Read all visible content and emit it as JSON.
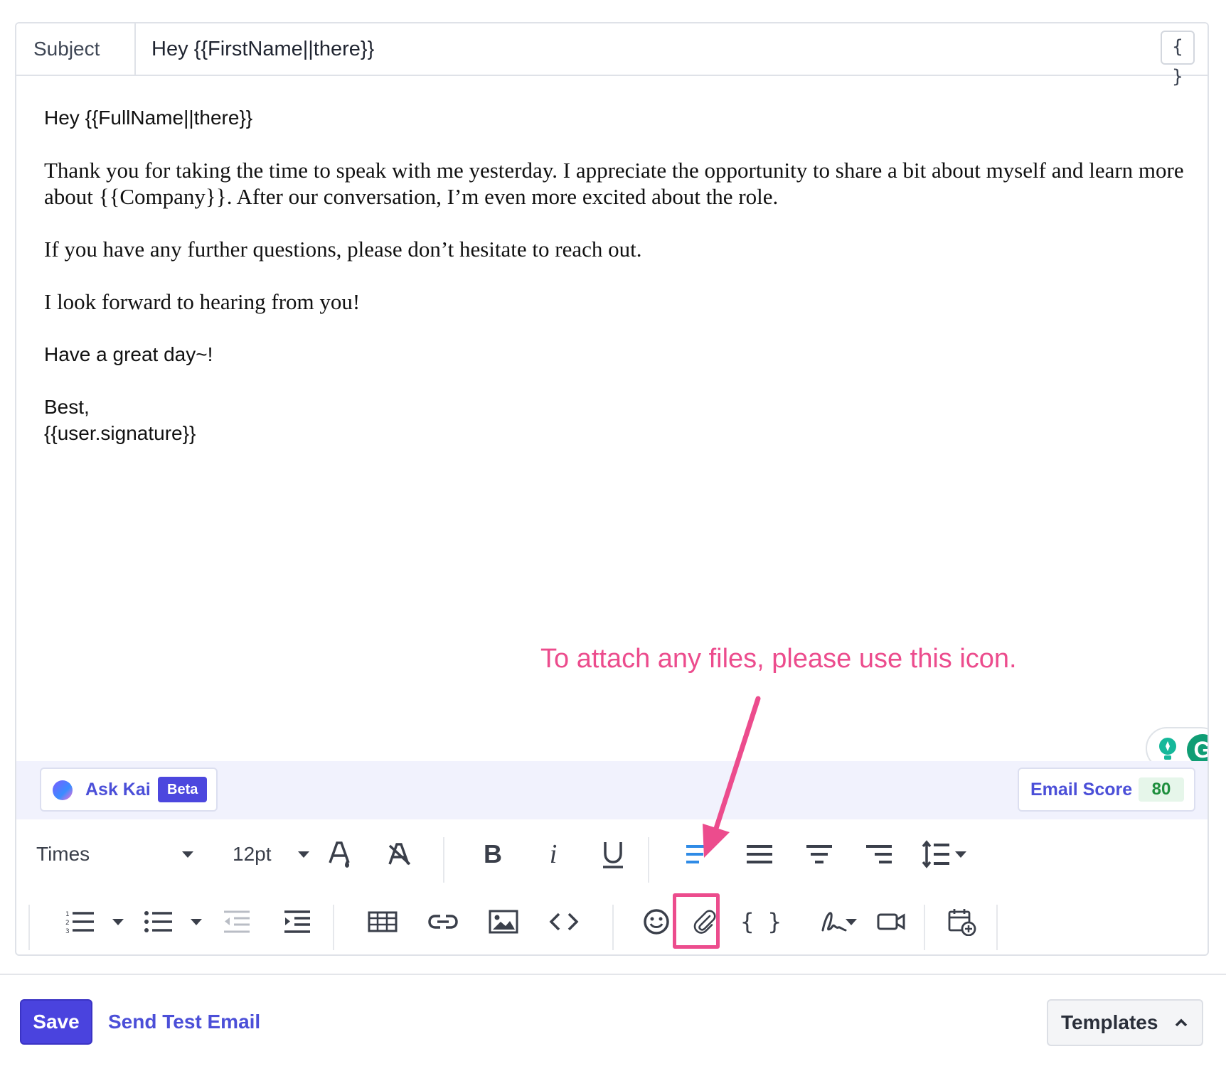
{
  "subject": {
    "label": "Subject",
    "value": "Hey {{FirstName||there}}"
  },
  "variables_button": "{ }",
  "body": {
    "greeting": "Hey {{FullName||there}}",
    "paragraph1": "Thank you for taking the time to speak with me yesterday. I appreciate the opportunity to share a bit about myself and learn more about {{Company}}. After our conversation, I’m even more excited about the role.",
    "paragraph2": "If you have any further questions, please don’t hesitate to reach out.",
    "paragraph3": "I look forward to hearing from you!",
    "paragraph4": "Have a great day~!",
    "closing": "Best,",
    "signature": "{{user.signature}}"
  },
  "annotation": "To attach any files, please use this icon.",
  "ask_kai": {
    "label": "Ask Kai",
    "badge": "Beta"
  },
  "email_score": {
    "label": "Email Score",
    "value": "80"
  },
  "toolbar": {
    "font_family": "Times",
    "font_size": "12pt",
    "bold": "B",
    "italic": "i",
    "variables": "{ }"
  },
  "footer": {
    "save": "Save",
    "send_test": "Send Test Email",
    "templates": "Templates"
  },
  "colors": {
    "accent": "#4a43de",
    "annotation": "#ec4c8d",
    "score_green": "#1f8f3e",
    "align_active": "#2f8be6"
  }
}
